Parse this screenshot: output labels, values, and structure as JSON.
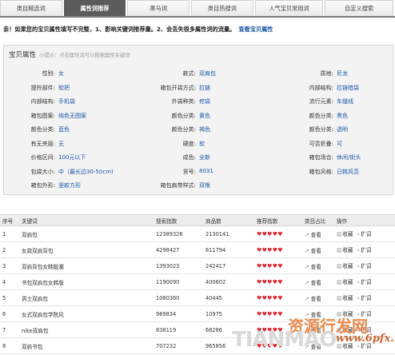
{
  "tabs": [
    {
      "label": "类目精选词",
      "active": false
    },
    {
      "label": "属性词推荐",
      "active": true
    },
    {
      "label": "黑马词",
      "active": false
    },
    {
      "label": "类目热搜词",
      "active": false
    },
    {
      "label": "人气宝贝常用词",
      "active": false
    },
    {
      "label": "自定义搜索",
      "active": false
    }
  ],
  "notice": {
    "text": "亲！如果您的宝贝属性填写不完整，1、影响关键词推荐量。2、会丢失很多属性词的流量。",
    "link": "查看宝贝属性"
  },
  "properties": {
    "title": "宝贝属性",
    "hint": "小提示：点击属性词可以搜索属性关键词",
    "rows": [
      [
        {
          "label": "性别:",
          "value": "女"
        },
        {
          "label": "款式:",
          "value": "双肩包"
        },
        {
          "label": "质地:",
          "value": "尼龙"
        }
      ],
      [
        {
          "label": "提拎部件:",
          "value": "软把"
        },
        {
          "label": "箱包开袋方式:",
          "value": "拉链"
        },
        {
          "label": "内部结构:",
          "value": "拉链暗袋"
        }
      ],
      [
        {
          "label": "内部结构:",
          "value": "手机袋"
        },
        {
          "label": "外袋种类:",
          "value": "挖袋"
        },
        {
          "label": "流行元素:",
          "value": "车缝线"
        }
      ],
      [
        {
          "label": "箱包图案:",
          "value": "纯色无图案"
        },
        {
          "label": "颜色分类:",
          "value": "黄色"
        },
        {
          "label": "颜色分类:",
          "value": "黑色"
        }
      ],
      [
        {
          "label": "颜色分类:",
          "value": "蓝色"
        },
        {
          "label": "颜色分类:",
          "value": "褐色"
        },
        {
          "label": "颜色分类:",
          "value": "透明"
        }
      ],
      [
        {
          "label": "有无夹层:",
          "value": "无"
        },
        {
          "label": "硬度:",
          "value": "软"
        },
        {
          "label": "可否折叠:",
          "value": "可"
        }
      ],
      [
        {
          "label": "价格区间:",
          "value": "100元以下"
        },
        {
          "label": "成色:",
          "value": "全新"
        },
        {
          "label": "箱包场合:",
          "value": "休闲/街头"
        }
      ],
      [
        {
          "label": "包袋大小:",
          "value": "中（最长边30-50cm)"
        },
        {
          "label": "货号:",
          "value": "8031"
        },
        {
          "label": "箱包风格:",
          "value": "日韩风范"
        }
      ],
      [
        {
          "label": "箱包外形:",
          "value": "竖款方形"
        },
        {
          "label": "箱包肩带样式:",
          "value": "双根"
        },
        {
          "label": "",
          "value": ""
        }
      ]
    ]
  },
  "table": {
    "headers": [
      "序号",
      "关键词",
      "搜索指数",
      "商品数",
      "推荐指数",
      "类目占比",
      "操作"
    ],
    "rows": [
      {
        "no": "1",
        "keyword": "双肩包",
        "search": "12389326",
        "goods": "2130141",
        "rec": "♥♥♥♥♥",
        "cat": "查看"
      },
      {
        "no": "2",
        "keyword": "女款双肩背包",
        "search": "4298427",
        "goods": "811794",
        "rec": "♥♥♥♥♥",
        "cat": "查看"
      },
      {
        "no": "3",
        "keyword": "双肩背包女韩版潮",
        "search": "1393023",
        "goods": "242417",
        "rec": "♥♥♥♥♥",
        "cat": "查看"
      },
      {
        "no": "4",
        "keyword": "书包双肩包女韩版",
        "search": "1190090",
        "goods": "400602",
        "rec": "♥♥♥♥♥",
        "cat": "查看"
      },
      {
        "no": "5",
        "keyword": "男士双肩包",
        "search": "1080360",
        "goods": "40445",
        "rec": "♥♥♥♥♥",
        "cat": "查看"
      },
      {
        "no": "6",
        "keyword": "女式双肩包学院风",
        "search": "969834",
        "goods": "10975",
        "rec": "♥♥♥♥♥",
        "cat": "查看"
      },
      {
        "no": "7",
        "keyword": "nike双肩包",
        "search": "838119",
        "goods": "68286",
        "rec": "♥♥♥♥♥",
        "cat": "查看"
      },
      {
        "no": "8",
        "keyword": "双肩书包",
        "search": "707232",
        "goods": "965856",
        "rec": "♥♥♥♥♥",
        "cat": "查看"
      }
    ],
    "op_collect": "收藏",
    "op_expand": "扩词"
  },
  "watermark": {
    "top": "资源行发网",
    "mid": "TIANMAO",
    "bottom": "www.6pfx.net"
  },
  "colors": {
    "link": "#1b57a8",
    "heart": "#e0232e",
    "active_tab": "#5b5b5b"
  }
}
